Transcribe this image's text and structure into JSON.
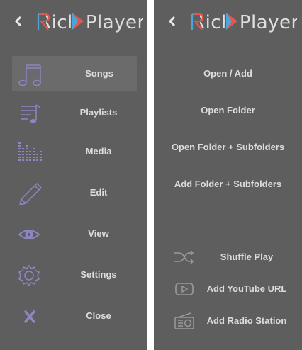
{
  "app": {
    "logo_text": "Rich Player",
    "colors": {
      "panel_bg": "#5e5e5e",
      "active_bg": "#6b6b6b",
      "text": "#dcdcdc",
      "icon_purple": "#8d87c4",
      "logo_red": "#e2574c",
      "logo_blue": "#4aa6d8"
    }
  },
  "left_menu": {
    "back_icon": "chevron-left-icon",
    "items": [
      {
        "label": "Songs",
        "icon": "music-notes-icon",
        "active": true
      },
      {
        "label": "Playlists",
        "icon": "playlist-icon"
      },
      {
        "label": "Media",
        "icon": "equalizer-icon"
      },
      {
        "label": "Edit",
        "icon": "pencil-icon"
      },
      {
        "label": "View",
        "icon": "eye-icon"
      },
      {
        "label": "Settings",
        "icon": "gear-icon"
      },
      {
        "label": "Close",
        "icon": "close-x-icon"
      }
    ]
  },
  "right_menu": {
    "back_icon": "chevron-left-icon",
    "actions": [
      {
        "label": "Open / Add"
      },
      {
        "label": "Open Folder"
      },
      {
        "label": "Open Folder + Subfolders"
      },
      {
        "label": "Add Folder + Subfolders"
      }
    ],
    "extras": [
      {
        "label": "Shuffle Play",
        "icon": "shuffle-icon"
      },
      {
        "label": "Add YouTube URL",
        "icon": "youtube-icon"
      },
      {
        "label": "Add Radio Station",
        "icon": "radio-icon"
      }
    ]
  }
}
